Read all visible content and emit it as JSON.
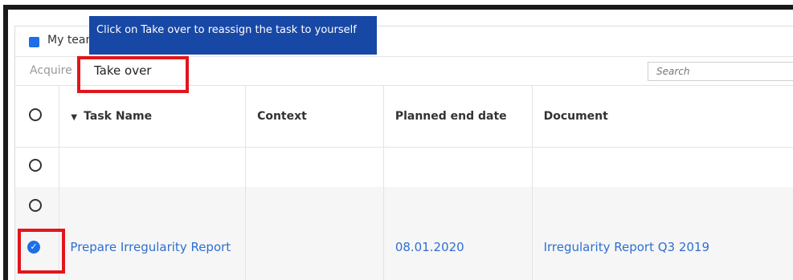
{
  "filter": {
    "label": "My team(s) tasks"
  },
  "tooltip": {
    "text": "Click on Take over to reassign the task to yourself"
  },
  "toolbar": {
    "acquire_label": "Acquire",
    "takeover_label": "Take over"
  },
  "search": {
    "placeholder": "Search"
  },
  "table": {
    "headers": {
      "task_name": "Task Name",
      "context": "Context",
      "planned_end_date": "Planned end date",
      "document": "Document"
    },
    "rows": [
      {
        "selected": false,
        "task_name": "",
        "context": "",
        "planned_end_date": "",
        "document": ""
      },
      {
        "selected": false,
        "task_name": "",
        "context": "",
        "planned_end_date": "",
        "document": ""
      },
      {
        "selected": true,
        "task_name": "Prepare Irregularity Report",
        "context": "",
        "planned_end_date": "08.01.2020",
        "document": "Irregularity Report Q3 2019"
      }
    ]
  },
  "colors": {
    "accent": "#1d6ee8",
    "link": "#2f6fd1",
    "tooltip_bg": "#1848a6",
    "highlight": "#e1161c"
  }
}
